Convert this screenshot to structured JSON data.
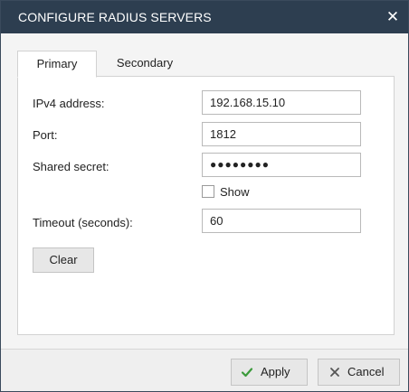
{
  "dialog": {
    "title": "CONFIGURE RADIUS SERVERS",
    "close_icon": "close-icon"
  },
  "tabs": [
    {
      "label": "Primary",
      "active": true
    },
    {
      "label": "Secondary",
      "active": false
    }
  ],
  "form": {
    "ipv4_label": "IPv4 address:",
    "ipv4_value": "192.168.15.10",
    "port_label": "Port:",
    "port_value": "1812",
    "secret_label": "Shared secret:",
    "secret_mask": "●●●●●●●●",
    "show_label": "Show",
    "show_checked": false,
    "timeout_label": "Timeout (seconds):",
    "timeout_value": "60",
    "clear_label": "Clear"
  },
  "footer": {
    "apply_label": "Apply",
    "apply_icon": "check-icon",
    "cancel_label": "Cancel",
    "cancel_icon": "x-icon"
  },
  "colors": {
    "titlebar": "#2d3e50",
    "check": "#3a9a3a",
    "cancel_x": "#555555"
  }
}
